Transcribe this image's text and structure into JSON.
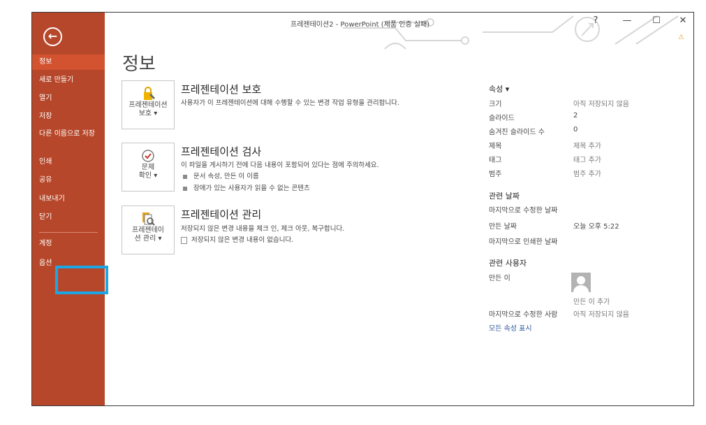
{
  "window": {
    "title": "프레젠테이션2 - PowerPoint (제품 인증 실패)",
    "help": "?",
    "minimize": "—",
    "maximize": "☐",
    "close": "✕",
    "warning": "⚠"
  },
  "nav": {
    "back_symbol": "←",
    "items": [
      {
        "label": "정보"
      },
      {
        "label": "새로 만들기"
      },
      {
        "label": "열기"
      },
      {
        "label": "저장"
      },
      {
        "label": "다른 이름으로 저장"
      },
      {
        "label": "인쇄"
      },
      {
        "label": "공유"
      },
      {
        "label": "내보내기"
      },
      {
        "label": "닫기"
      },
      {
        "label": "계정"
      },
      {
        "label": "옵션"
      }
    ]
  },
  "page_title": "정보",
  "sections": [
    {
      "card_label": "프레젠테이션\n보호 ▾",
      "title": "프레젠테이션 보호",
      "desc": "사용자가 이 프레젠테이션에 대해 수행할 수 있는 변경 작업 유형을 관리합니다."
    },
    {
      "card_label": "문제\n확인 ▾",
      "title": "프레젠테이션 검사",
      "desc": "이 파일을 게시하기 전에 다음 내용이 포함되어 있다는 점에 주의하세요.",
      "bullets": [
        "문서 속성, 만든 이 이름",
        "장애가 있는 사용자가 읽을 수 없는 콘텐츠"
      ]
    },
    {
      "card_label": "프레젠테이\n션 관리 ▾",
      "title": "프레젠테이션 관리",
      "desc": "저장되지 않은 변경 내용을 체크 인, 체크 아웃, 복구합니다.",
      "note": "저장되지 않은 변경 내용이 없습니다."
    }
  ],
  "properties": {
    "header": "속성 ▾",
    "rows": [
      {
        "label": "크기",
        "value": "아직 저장되지 않음"
      },
      {
        "label": "슬라이드",
        "value": "2"
      },
      {
        "label": "숨겨진 슬라이드 수",
        "value": "0"
      },
      {
        "label": "제목",
        "value": "제목 추가"
      },
      {
        "label": "태그",
        "value": "태그 추가"
      },
      {
        "label": "범주",
        "value": "범주 추가"
      }
    ]
  },
  "related_dates": {
    "header": "관련 날짜",
    "rows": [
      {
        "label": "마지막으로 수정한 날짜",
        "value": ""
      },
      {
        "label": "만든 날짜",
        "value": "오늘 오후 5:22"
      },
      {
        "label": "마지막으로 인쇄한 날짜",
        "value": ""
      }
    ]
  },
  "related_people": {
    "header": "관련 사용자",
    "author_label": "만든 이",
    "add_author": "만든 이 추가",
    "last_modified_by_label": "마지막으로 수정한 사람",
    "last_modified_by_value": "아직 저장되지 않음"
  },
  "show_all_link": "모든 속성 표시",
  "colors": {
    "nav_bg": "#b7472a",
    "nav_active": "#d35230",
    "highlight": "#1ca6e4",
    "link": "#2b579a"
  }
}
